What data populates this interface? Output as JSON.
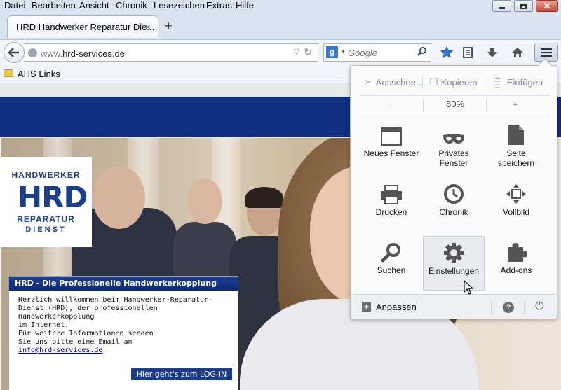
{
  "menubar": {
    "items": [
      "Datei",
      "Bearbeiten",
      "Ansicht",
      "Chronik",
      "Lesezeichen",
      "Extras",
      "Hilfe"
    ]
  },
  "tab": {
    "title": "HRD Handwerker Reparatur Die...",
    "close": "×",
    "new_tab": "+"
  },
  "nav": {
    "url_prefix": "www.",
    "url_domain": "hrd-services.de",
    "search_engine_letter": "g",
    "search_placeholder": "Google"
  },
  "bookmarks": {
    "items": [
      {
        "label": "AHS Links"
      }
    ]
  },
  "page": {
    "logo": {
      "line1": "HANDWERKER",
      "mark": "HRD",
      "line2": "REPARATUR",
      "line3": "DIENST"
    },
    "infobox": {
      "title": "HRD - Die Professionelle Handwerkerkopplung",
      "lines": [
        "Herzlich willkommen beim Handwerker-Reparatur-",
        "Dienst (HRD), der professionellen",
        "Handwerkerkopplung",
        "im Internet.",
        "",
        "Für weitere Informationen senden",
        "Sie uns bitte eine Email an"
      ],
      "email": "info@hrd-services.de",
      "login_button": "Hier geht's zum LOG-IN"
    }
  },
  "menu_panel": {
    "edit": {
      "cut": "Ausschne...",
      "copy": "Kopieren",
      "paste": "Einfügen"
    },
    "zoom": {
      "minus": "−",
      "level": "80%",
      "plus": "+"
    },
    "items": [
      {
        "label": "Neues Fenster",
        "icon": "window-icon"
      },
      {
        "label": "Privates Fenster",
        "icon": "mask-icon"
      },
      {
        "label": "Seite speichern",
        "icon": "page-icon"
      },
      {
        "label": "Drucken",
        "icon": "printer-icon"
      },
      {
        "label": "Chronik",
        "icon": "clock-icon"
      },
      {
        "label": "Vollbild",
        "icon": "fullscreen-icon"
      },
      {
        "label": "Suchen",
        "icon": "search-icon"
      },
      {
        "label": "Einstellungen",
        "icon": "gear-icon"
      },
      {
        "label": "Add-ons",
        "icon": "puzzle-icon"
      }
    ],
    "customize": "Anpassen",
    "help_symbol": "?"
  }
}
